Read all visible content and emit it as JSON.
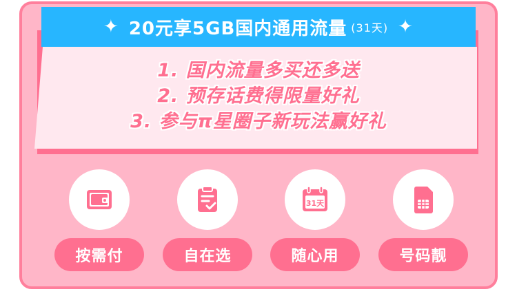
{
  "banner": {
    "title": "20元享5GB国内通用流量",
    "duration": "(31天)",
    "left_icon": "sparkle-icon",
    "right_icon": "sparkle-icon"
  },
  "features": [
    "1. 国内流量多买还多送",
    "2. 预存话费得限量好礼",
    "3. 参与π星圈子新玩法赢好礼"
  ],
  "actions": [
    {
      "label": "按需付",
      "icon": "wallet-icon"
    },
    {
      "label": "自在选",
      "icon": "clipboard-check-icon"
    },
    {
      "label": "随心用",
      "icon": "calendar-icon",
      "icon_text": "31天"
    },
    {
      "label": "号码靓",
      "icon": "sim-card-icon"
    }
  ],
  "colors": {
    "card_background": "#ffb6c8",
    "card_border": "#ff7f9c",
    "accent_pink": "#ff6f90",
    "banner_blue": "#27b6ff",
    "banner_body": "#ffe8ef"
  }
}
